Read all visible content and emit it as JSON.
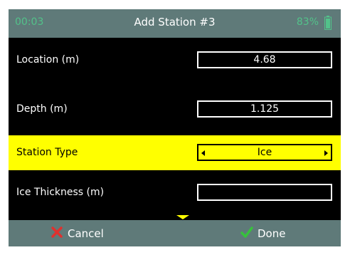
{
  "status": {
    "time": "00:03",
    "title": "Add Station #3",
    "battery": "83%"
  },
  "fields": [
    {
      "label": "Location (m)",
      "value": "4.68"
    },
    {
      "label": "Depth (m)",
      "value": "1.125"
    },
    {
      "label": "Station Type",
      "value": "Ice"
    },
    {
      "label": "Ice Thickness (m)",
      "value": ""
    }
  ],
  "actions": {
    "cancel": "Cancel",
    "done": "Done"
  },
  "colors": {
    "accent": "#ffff00",
    "bar": "#5f7a79",
    "status_green": "#52c28a",
    "cancel_red": "#e0312e",
    "done_green": "#37c23c"
  },
  "icons": {
    "battery": "battery-icon",
    "cancel": "x-icon",
    "done": "check-icon",
    "left": "arrow-left-icon",
    "right": "arrow-right-icon",
    "scroll": "chevron-down-icon"
  }
}
